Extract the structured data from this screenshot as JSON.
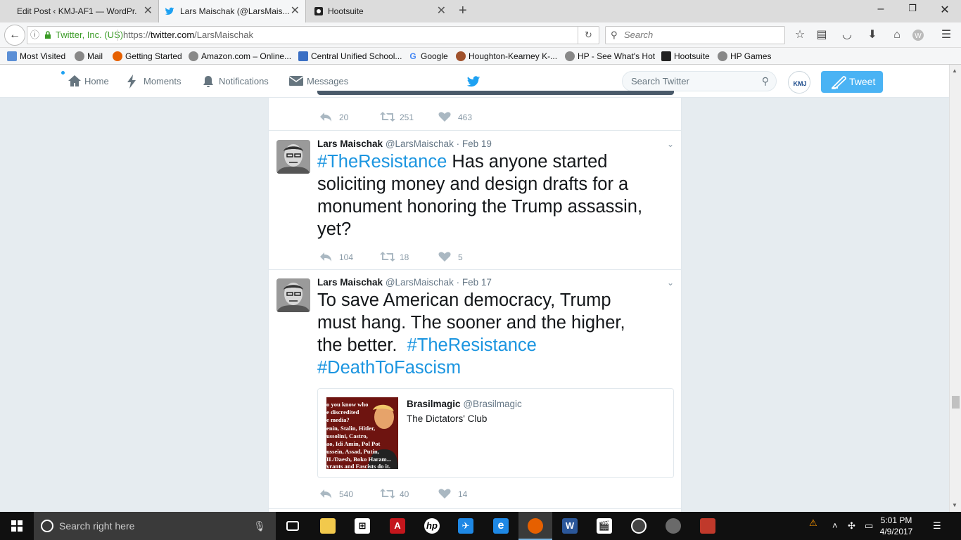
{
  "browser": {
    "tabs": [
      {
        "title": "Edit Post ‹ KMJ-AF1 — WordPr...",
        "active": false
      },
      {
        "title": "Lars Maischak (@LarsMais...",
        "active": true
      },
      {
        "title": "Hootsuite",
        "active": false
      }
    ],
    "identity": "Twitter, Inc. (US)",
    "url_prefix": "https://",
    "url_host": "twitter.com",
    "url_path": "/LarsMaischak",
    "search_placeholder": "Search",
    "bookmarks": [
      "Most Visited",
      "Mail",
      "Getting Started",
      "Amazon.com – Online...",
      "Central Unified School...",
      "Google",
      "Houghton-Kearney K-...",
      "HP - See What's Hot",
      "Hootsuite",
      "HP Games"
    ]
  },
  "twitter_nav": {
    "home": "Home",
    "moments": "Moments",
    "notifications": "Notifications",
    "messages": "Messages",
    "search_placeholder": "Search Twitter",
    "tweet_button": "Tweet"
  },
  "tweets": [
    {
      "actions": {
        "replies": "20",
        "retweets": "251",
        "likes": "463"
      }
    },
    {
      "name": "Lars Maischak",
      "handle": "@LarsMaischak",
      "time": "· Feb 19",
      "hashtag_start": "#TheResistance",
      "text": " Has anyone started soliciting money and design drafts for a monument honoring the Trump assassin, yet?",
      "actions": {
        "replies": "104",
        "retweets": "18",
        "likes": "5"
      }
    },
    {
      "name": "Lars Maischak",
      "handle": "@LarsMaischak",
      "time": "· Feb 17",
      "text_line_1": "To save American democracy, Trump",
      "text_line_2": "must hang.  The sooner and the higher,",
      "text_line_3": "the better.  ",
      "hashtag_1": "#TheResistance",
      "hashtag_2": "#DeathToFascism",
      "quote": {
        "name": "Brasilmagic",
        "handle": "@Brasilmagic",
        "text": "The Dictators' Club",
        "image_lines": [
          "o you know who",
          "e discredited",
          "e media?",
          "enin, Stalin, Hitler,",
          "ussolini, Castro,",
          "ao, Idi Amin, Pol Pot",
          "ussein, Assad, Putin,",
          "IL/Daesh, Boko Haram...",
          "yrants and Fascists do it."
        ]
      },
      "actions": {
        "replies": "540",
        "retweets": "40",
        "likes": "14"
      }
    }
  ],
  "taskbar": {
    "search_placeholder": "Search right here",
    "time": "5:01 PM",
    "date": "4/9/2017"
  },
  "colors": {
    "twitter_blue": "#1da1f2",
    "hashtag": "#1b95e0",
    "tweet_button": "#4ab3f4"
  }
}
